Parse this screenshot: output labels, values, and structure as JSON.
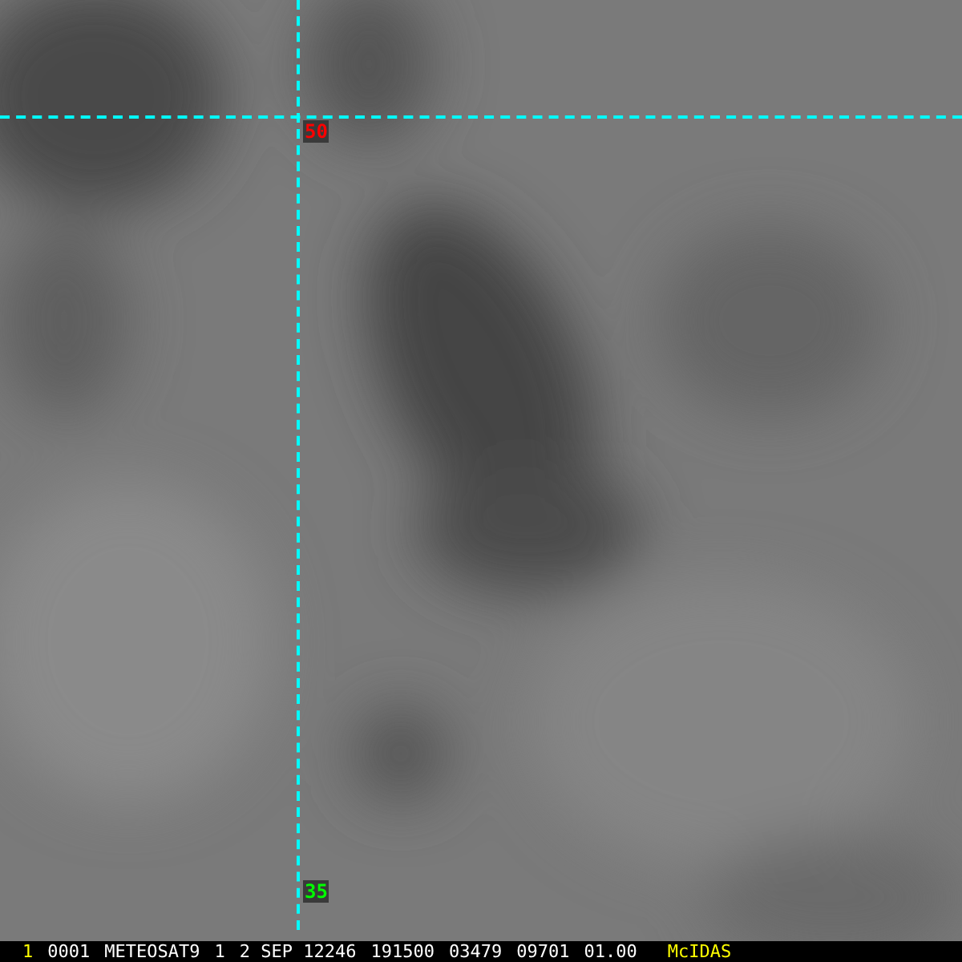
{
  "grid_labels": [
    {
      "text": "50",
      "kind": "latitude"
    },
    {
      "text": "35",
      "kind": "longitude"
    }
  ],
  "status_bar": {
    "frame": "1",
    "fields": [
      "0001",
      "METEOSAT9",
      "1",
      "2 SEP 12246",
      "191500",
      "03479",
      "09701",
      "01.00"
    ],
    "product": "McIDAS"
  }
}
